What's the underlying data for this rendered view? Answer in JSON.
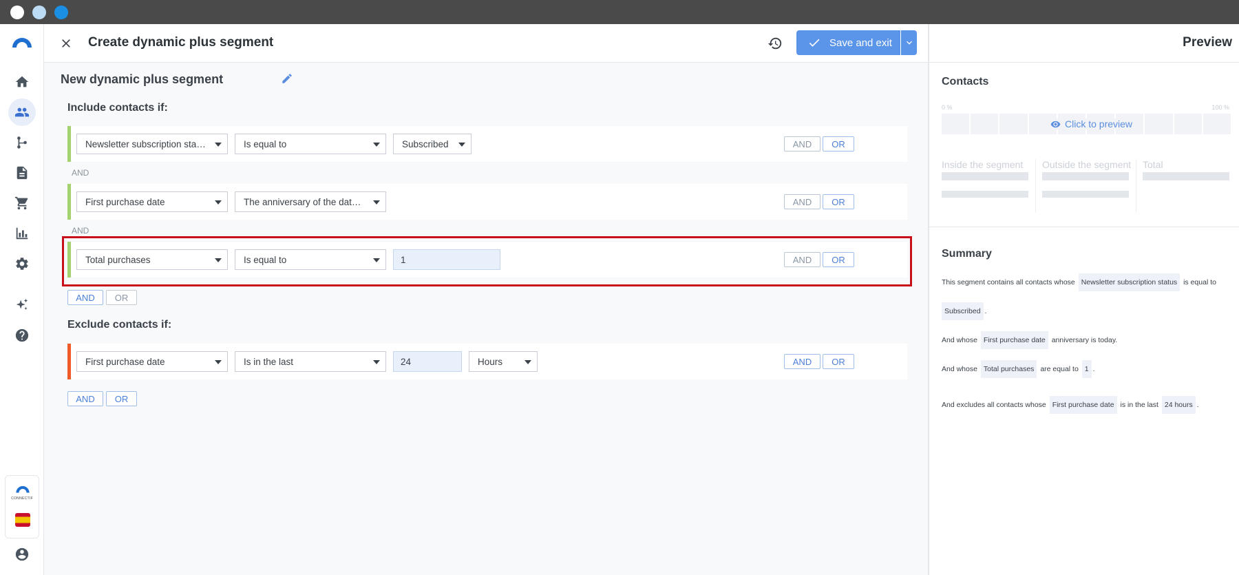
{
  "header": {
    "title": "Create dynamic plus segment",
    "save_label": "Save and exit"
  },
  "segment": {
    "name": "New dynamic plus segment"
  },
  "include": {
    "title": "Include contacts if:",
    "rows": [
      {
        "field": "Newsletter subscription status",
        "operator": "Is equal to",
        "value": "Subscribed"
      },
      {
        "field": "First purchase date",
        "operator": "The anniversary of the date is today"
      },
      {
        "field": "Total purchases",
        "operator": "Is equal to",
        "value": "1"
      }
    ],
    "separator": "AND"
  },
  "exclude": {
    "title": "Exclude contacts if:",
    "rows": [
      {
        "field": "First purchase date",
        "operator": "Is in the last",
        "value": "24",
        "unit": "Hours"
      }
    ]
  },
  "logic": {
    "and": "AND",
    "or": "OR"
  },
  "brand": {
    "text": "CONNECTIF"
  },
  "preview": {
    "title": "Preview",
    "contacts_title": "Contacts",
    "pct_min": "0 %",
    "pct_max": "100 %",
    "click_preview": "Click to preview",
    "inside": "Inside the segment",
    "outside": "Outside the segment",
    "total": "Total",
    "summary_title": "Summary",
    "summary": {
      "l1_a": "This segment contains all contacts whose",
      "l1_tag": "Newsletter subscription status",
      "l1_b": "is equal to",
      "l2_tag": "Subscribed",
      "l2_b": ".",
      "l3_a": "And whose",
      "l3_tag": "First purchase date",
      "l3_b": "anniversary is today.",
      "l4_a": "And whose",
      "l4_tag": "Total purchases",
      "l4_b": "are equal to",
      "l4_tag2": "1",
      "l4_c": ".",
      "l5_a": "And excludes all contacts whose",
      "l5_tag": "First purchase date",
      "l5_b": "is in the last",
      "l5_tag2": "24 hours",
      "l5_c": "."
    }
  },
  "colors": {
    "primary": "#5b95ea",
    "include_bar": "#a4d26e",
    "exclude_bar": "#f05a28",
    "highlight": "#c8101a"
  },
  "icons": [
    "home-icon",
    "contacts-icon",
    "workflow-icon",
    "content-icon",
    "cart-icon",
    "analytics-icon",
    "settings-icon",
    "sparkle-icon",
    "help-icon",
    "account-icon",
    "close-icon",
    "history-icon",
    "check-icon",
    "chevron-down-icon",
    "edit-icon",
    "eye-icon"
  ]
}
